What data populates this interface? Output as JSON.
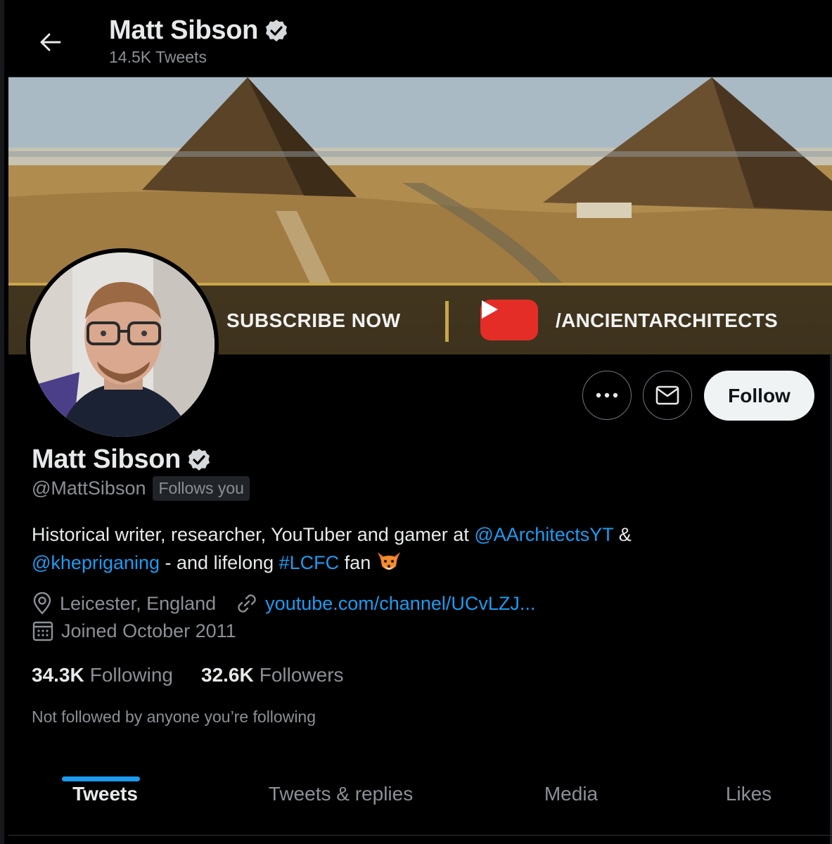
{
  "header": {
    "name": "Matt Sibson",
    "tweet_count": "14.5K Tweets"
  },
  "banner": {
    "subscribe_text": "SUBSCRIBE NOW",
    "channel_text": "/ANCIENTARCHITECTS",
    "colors": {
      "accent_strip": "#c8a64a",
      "youtube_red": "#e52d27"
    }
  },
  "actions": {
    "more_icon": "more-dots-icon",
    "message_icon": "envelope-icon",
    "follow_label": "Follow"
  },
  "profile": {
    "name": "Matt Sibson",
    "verified": true,
    "handle": "@MattSibson",
    "follows_you": "Follows you",
    "bio": {
      "line1_text": "Historical writer, researcher, YouTuber and gamer at ",
      "line1_mention": "@AArchitectsYT",
      "line1_tail": " &",
      "line2_mention": "@khepriganing",
      "line2_text": " - and lifelong ",
      "line2_hashtag": "#LCFC",
      "line2_tail": " fan "
    },
    "location": "Leicester, England",
    "website": "youtube.com/channel/UCvLZJ...",
    "joined": "Joined October 2011",
    "following_count": "34.3K",
    "following_label": "Following",
    "followers_count": "32.6K",
    "followers_label": "Followers",
    "not_followed_text": "Not followed by anyone you’re following"
  },
  "tabs": [
    {
      "label": "Tweets",
      "active": true
    },
    {
      "label": "Tweets & replies",
      "active": false
    },
    {
      "label": "Media",
      "active": false
    },
    {
      "label": "Likes",
      "active": false
    }
  ],
  "colors": {
    "background": "#000000",
    "text_primary": "#e7e9ea",
    "text_secondary": "#8b9096",
    "accent_blue": "#1d9bf0"
  }
}
